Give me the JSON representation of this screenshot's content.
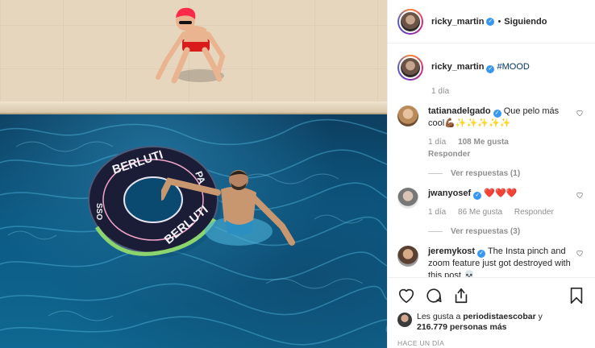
{
  "header": {
    "username": "ricky_martin",
    "separator": "•",
    "follow_status": "Siguiendo"
  },
  "caption": {
    "username": "ricky_martin",
    "text": "#MOOD",
    "time": "1 día"
  },
  "comments": [
    {
      "username": "tatianadelgado",
      "verified": true,
      "text": "Que pelo más cool💪🏾✨✨✨✨✨",
      "time": "1 día",
      "likes": "108 Me gusta",
      "reply": "Responder",
      "view_replies": "Ver respuestas (1)"
    },
    {
      "username": "jwanyosef",
      "verified": true,
      "text": "❤️❤️❤️",
      "time": "1 día",
      "likes": "86 Me gusta",
      "reply": "Responder",
      "view_replies": "Ver respuestas (3)"
    },
    {
      "username": "jeremykost",
      "verified": true,
      "text": "The Insta pinch and zoom feature just got destroyed with this post 💀"
    }
  ],
  "actions": {
    "likes_prefix": "Les gusta a",
    "liked_by": "periodistaescobar",
    "likes_middle": "y",
    "likes_count": "216.779",
    "likes_suffix": "personas más",
    "timestamp": "HACE UN DÍA"
  },
  "photo": {
    "float_text_top": "BERLUTI",
    "float_text_bottom": "BERLUTI",
    "float_text_side": "PA",
    "float_text_left": "SSO"
  },
  "colors": {
    "verified": "#3897f0",
    "hashtag": "#003569",
    "muted": "#8e8e8e",
    "water": "#0b5a84"
  }
}
